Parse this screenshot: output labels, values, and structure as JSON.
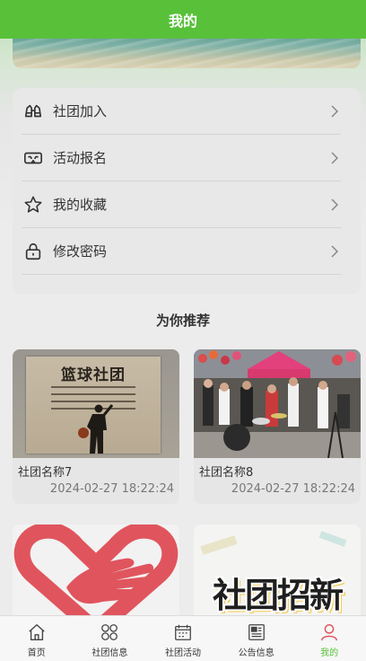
{
  "header": {
    "title": "我的"
  },
  "menu": {
    "items": [
      {
        "label": "社团加入",
        "icon": "binoculars-icon"
      },
      {
        "label": "活动报名",
        "icon": "vr-goggles-icon"
      },
      {
        "label": "我的收藏",
        "icon": "star-icon"
      },
      {
        "label": "修改密码",
        "icon": "lock-icon"
      }
    ]
  },
  "recommend": {
    "title": "为你推荐",
    "items": [
      {
        "name": "社团名称7",
        "time": "2024-02-27 18:22:24",
        "image": "篮球社团"
      },
      {
        "name": "社团名称8",
        "time": "2024-02-27 18:22:24",
        "image": "band-performance-photo"
      },
      {
        "name": "",
        "time": "",
        "image": "heart-hand-logo"
      },
      {
        "name": "",
        "time": "",
        "image": "社团招新"
      }
    ]
  },
  "nav": {
    "items": [
      {
        "label": "首页",
        "icon": "home-icon"
      },
      {
        "label": "社团信息",
        "icon": "grid-icon"
      },
      {
        "label": "社团活动",
        "icon": "calendar-icon"
      },
      {
        "label": "公告信息",
        "icon": "newspaper-icon"
      },
      {
        "label": "我的",
        "icon": "user-icon"
      }
    ],
    "active_index": 4
  },
  "colors": {
    "primary": "#58c139",
    "heart_red": "#e0555d"
  }
}
